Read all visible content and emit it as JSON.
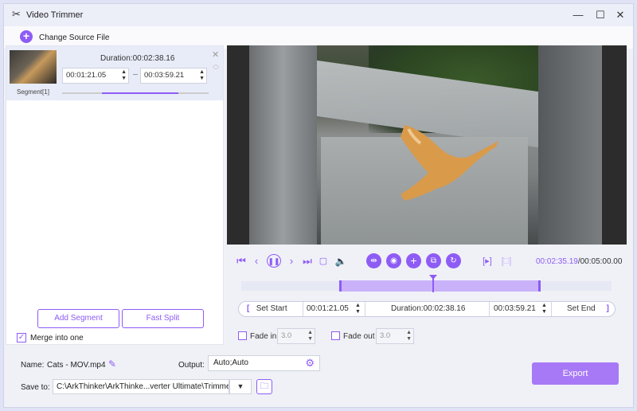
{
  "window": {
    "title": "Video Trimmer",
    "app_icon": "scissors-icon",
    "controls": [
      "minimize-icon",
      "maximize-icon",
      "close-icon"
    ]
  },
  "toolbar": {
    "change_source_label": "Change Source File"
  },
  "segment": {
    "duration": "Duration:00:02:38.16",
    "start": "00:01:21.05",
    "end": "00:03:59.21",
    "label": "Segment[1]",
    "progress_fraction": 0.52
  },
  "left_panel": {
    "add_segment_label": "Add Segment",
    "fast_split_label": "Fast Split",
    "merge_label": "Merge into one",
    "merge_checked": true
  },
  "player": {
    "current_time": "00:02:35.19",
    "total_time": "/00:05:00.00"
  },
  "trim": {
    "set_start_label": "Set Start",
    "start": "00:01:21.05",
    "duration": "Duration:00:02:38.16",
    "end": "00:03:59.21",
    "set_end_label": "Set End",
    "bracket_open": "[",
    "bracket_close": "]"
  },
  "fade": {
    "fade_in_label": "Fade in",
    "fade_in_value": "3.0",
    "fade_out_label": "Fade out",
    "fade_out_value": "3.0"
  },
  "bottom": {
    "name_label": "Name:",
    "name_value": "Cats - MOV.mp4",
    "output_label": "Output:",
    "output_value": "Auto;Auto",
    "save_label": "Save to:",
    "save_path": "C:\\ArkThinker\\ArkThinke...verter Ultimate\\Trimmer",
    "export_label": "Export"
  },
  "colors": {
    "accent": "#8e5cf5",
    "export": "#a879f6"
  }
}
